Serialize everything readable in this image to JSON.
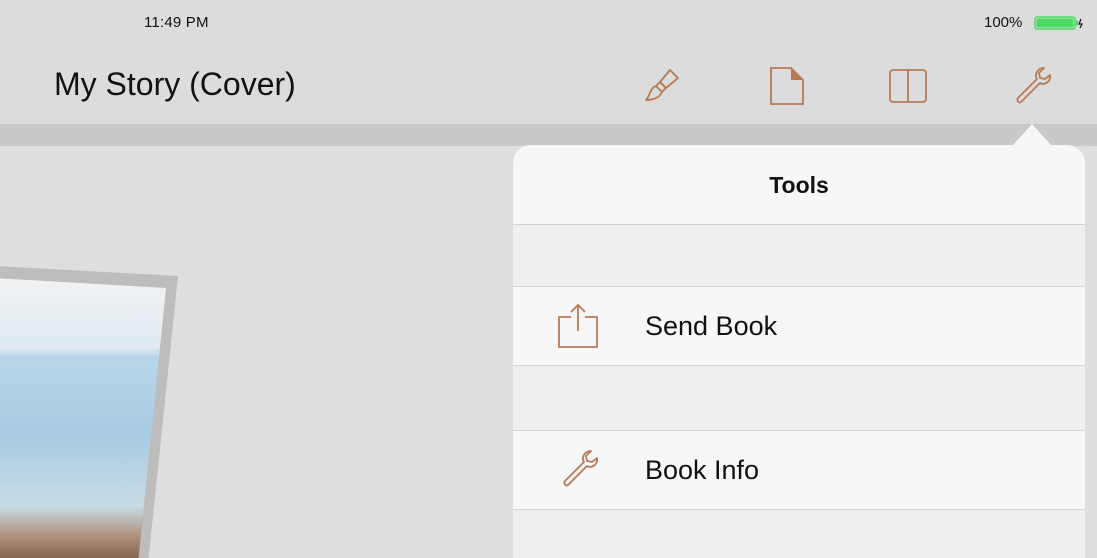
{
  "status_bar": {
    "time": "11:49 PM",
    "battery_percent": "100%",
    "battery_level": 1.0,
    "battery_color": "#4cd964"
  },
  "nav": {
    "title": "My Story (Cover)",
    "icons": [
      "paintbrush-icon",
      "page-icon",
      "book-icon",
      "wrench-icon"
    ],
    "accent_color": "#b87a55"
  },
  "popover": {
    "title": "Tools",
    "items": [
      {
        "label": "Send Book",
        "icon": "share-icon"
      },
      {
        "label": "Book Info",
        "icon": "wrench-icon"
      }
    ]
  }
}
